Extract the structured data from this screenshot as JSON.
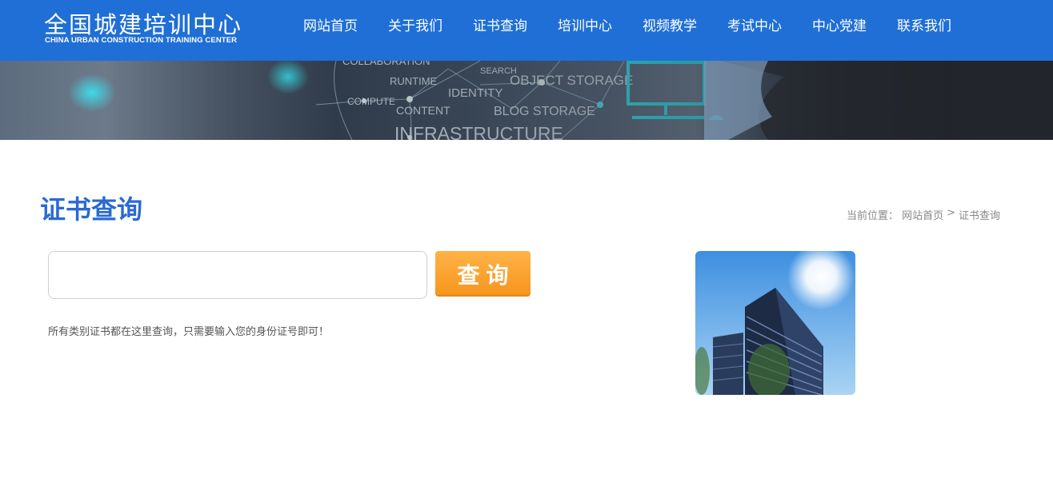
{
  "header": {
    "logo_title": "全国城建培训中心",
    "logo_subtitle": "CHINA URBAN CONSTRUCTION TRAINING CENTER",
    "nav": [
      {
        "label": "网站首页"
      },
      {
        "label": "关于我们"
      },
      {
        "label": "证书查询"
      },
      {
        "label": "培训中心"
      },
      {
        "label": "视频教学"
      },
      {
        "label": "考试中心"
      },
      {
        "label": "中心党建"
      },
      {
        "label": "联系我们"
      }
    ]
  },
  "banner": {
    "words": [
      "COLLABORATION",
      "RUNTIME",
      "SEARCH",
      "OBJECT STORAGE",
      "IDENTITY",
      "COMPUTE",
      "CONTENT",
      "BLOG STORAGE",
      "INFRASTRUCTURE"
    ]
  },
  "page": {
    "title": "证书查询",
    "breadcrumb": {
      "prefix": "当前位置：",
      "home": "网站首页",
      "separator": ">",
      "current": "证书查询"
    }
  },
  "search": {
    "value": "",
    "placeholder": "",
    "button_label": "查询",
    "hint": "所有类别证书都在这里查询，只需要输入您的身份证号即可！"
  },
  "colors": {
    "header_bg": "#1f6fd6",
    "title": "#2a6ad3",
    "button": "#f7941d"
  }
}
